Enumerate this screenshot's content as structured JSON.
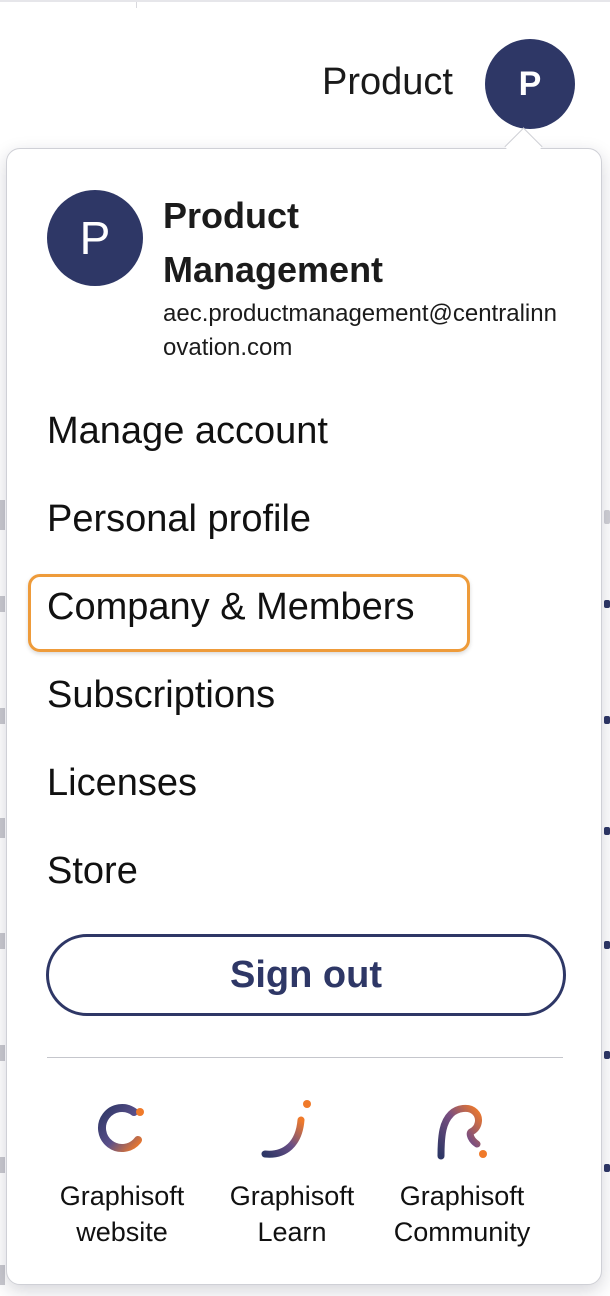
{
  "header": {
    "user_display_name": "Product",
    "avatar_initial": "P"
  },
  "account_menu": {
    "avatar_initial": "P",
    "profile_name": "Product Management",
    "profile_email": "aec.productmanagement@centralinnovation.com",
    "items": [
      {
        "label": "Manage account"
      },
      {
        "label": "Personal profile"
      },
      {
        "label": "Company & Members",
        "highlighted": true
      },
      {
        "label": "Subscriptions"
      },
      {
        "label": "Licenses"
      },
      {
        "label": "Store"
      }
    ],
    "sign_out_label": "Sign out",
    "links": [
      {
        "label": "Graphisoft\nwebsite",
        "icon": "graphisoft-website-icon"
      },
      {
        "label": "Graphisoft\nLearn",
        "icon": "graphisoft-learn-icon"
      },
      {
        "label": "Graphisoft\nCommunity",
        "icon": "graphisoft-community-icon"
      }
    ]
  },
  "colors": {
    "brand_navy": "#2e3766",
    "highlight_orange": "#ee9b3a"
  }
}
